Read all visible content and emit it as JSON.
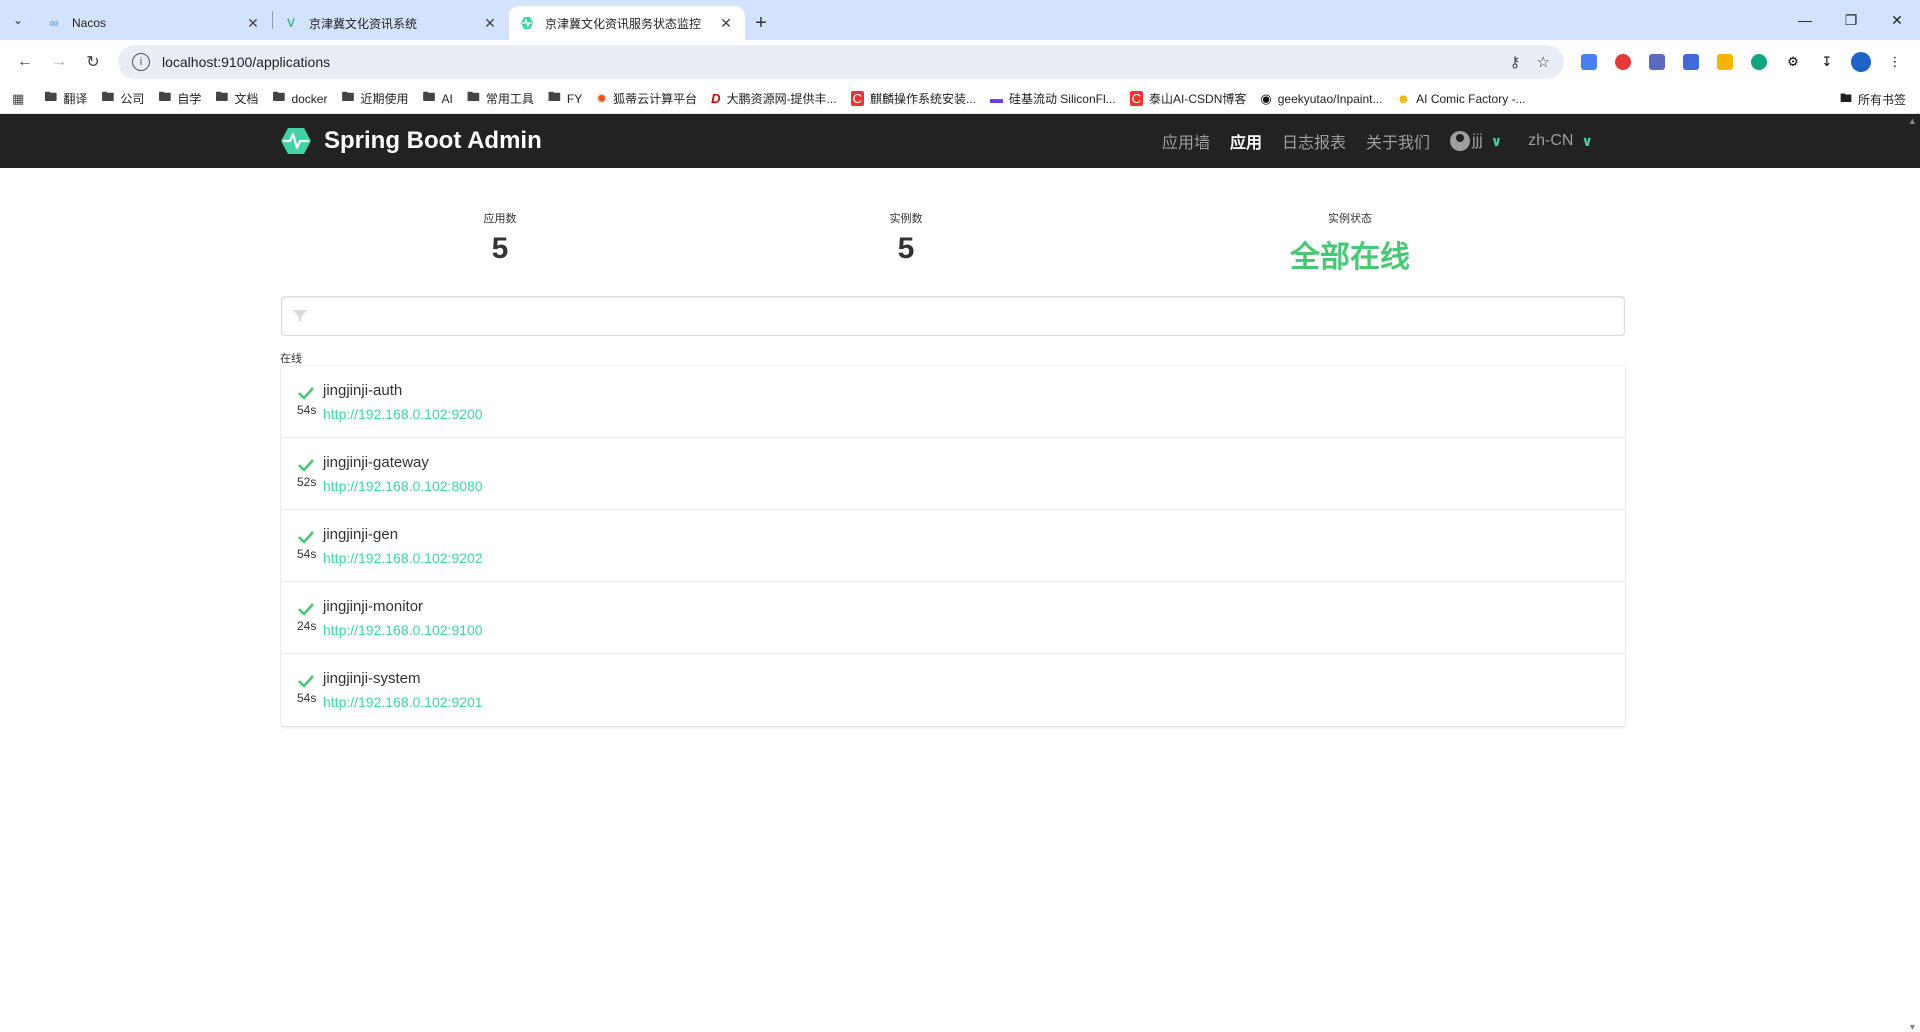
{
  "browser": {
    "tabs": [
      {
        "title": "Nacos",
        "icon": "infinity-icon",
        "active": false
      },
      {
        "title": "京津冀文化资讯系统",
        "icon": "vue-icon",
        "active": false
      },
      {
        "title": "京津冀文化资讯服务状态监控",
        "icon": "spring-boot-admin-icon",
        "active": true
      }
    ],
    "url": "localhost:9100/applications",
    "bookmarks": [
      "翻译",
      "公司",
      "自学",
      "文档",
      "docker",
      "近期使用",
      "AI",
      "常用工具",
      "FY",
      "狐蒂云计算平台",
      "大鹏资源网-提供丰...",
      "麒麟操作系统安装...",
      "硅基流动 SiliconFl...",
      "泰山AI-CSDN博客",
      "geekyutao/Inpaint...",
      "AI Comic Factory -..."
    ],
    "bookmarks_right": "所有书签"
  },
  "app": {
    "brand": "Spring Boot Admin",
    "nav": {
      "wallboard": "应用墙",
      "applications": "应用",
      "journal": "日志报表",
      "about": "关于我们",
      "user": "jjj",
      "language": "zh-CN"
    },
    "stats": {
      "apps_label": "应用数",
      "apps_value": "5",
      "instances_label": "实例数",
      "instances_value": "5",
      "status_label": "实例状态",
      "status_value": "全部在线"
    },
    "filter_placeholder": "",
    "group_label": "在线",
    "status_color": "#48c774",
    "accent_color": "#42d3a5",
    "applications": [
      {
        "name": "jingjinji-auth",
        "uptime": "54s",
        "url": "http://192.168.0.102:9200"
      },
      {
        "name": "jingjinji-gateway",
        "uptime": "52s",
        "url": "http://192.168.0.102:8080"
      },
      {
        "name": "jingjinji-gen",
        "uptime": "54s",
        "url": "http://192.168.0.102:9202"
      },
      {
        "name": "jingjinji-monitor",
        "uptime": "24s",
        "url": "http://192.168.0.102:9100"
      },
      {
        "name": "jingjinji-system",
        "uptime": "54s",
        "url": "http://192.168.0.102:9201"
      }
    ]
  }
}
